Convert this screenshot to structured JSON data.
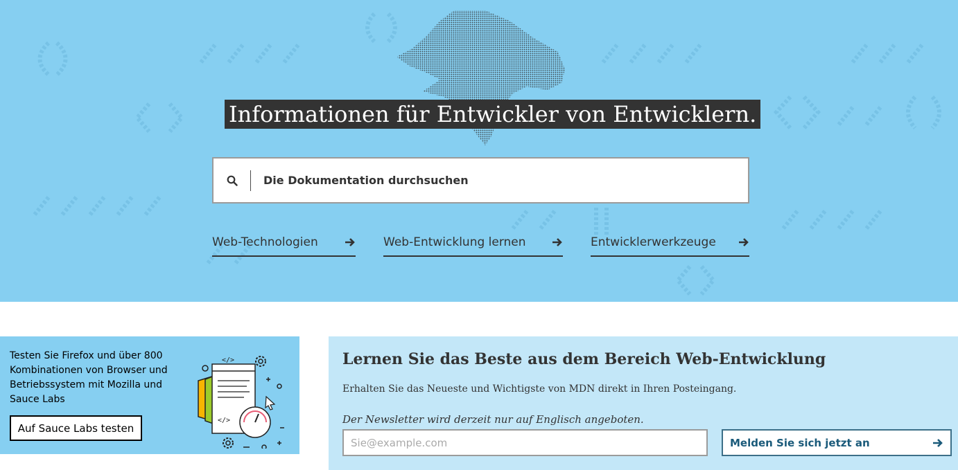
{
  "hero": {
    "headline": "Informationen für Entwickler von Entwicklern.",
    "background_color": "#86cff1",
    "search": {
      "placeholder": "Die Dokumentation durchsuchen"
    },
    "links": [
      {
        "label": "Web-Technologien"
      },
      {
        "label": "Web-Entwicklung lernen"
      },
      {
        "label": "Entwicklerwerkzeuge"
      }
    ]
  },
  "promo": {
    "text": "Testen Sie Firefox und über 800 Kombinationen von Browser und Betriebssystem mit Mozilla und Sauce Labs",
    "button_label": "Auf Sauce Labs testen",
    "code_tag": "</>"
  },
  "newsletter": {
    "title": "Lernen Sie das Beste aus dem Bereich Web-Entwicklung",
    "description": "Erhalten Sie das Neueste und Wichtigste von MDN direkt in Ihren Posteingang.",
    "note": "Der Newsletter wird derzeit nur auf Englisch angeboten.",
    "email_placeholder": "Sie@example.com",
    "submit_label": "Melden Sie sich jetzt an",
    "accent_color": "#1a5a7a"
  }
}
